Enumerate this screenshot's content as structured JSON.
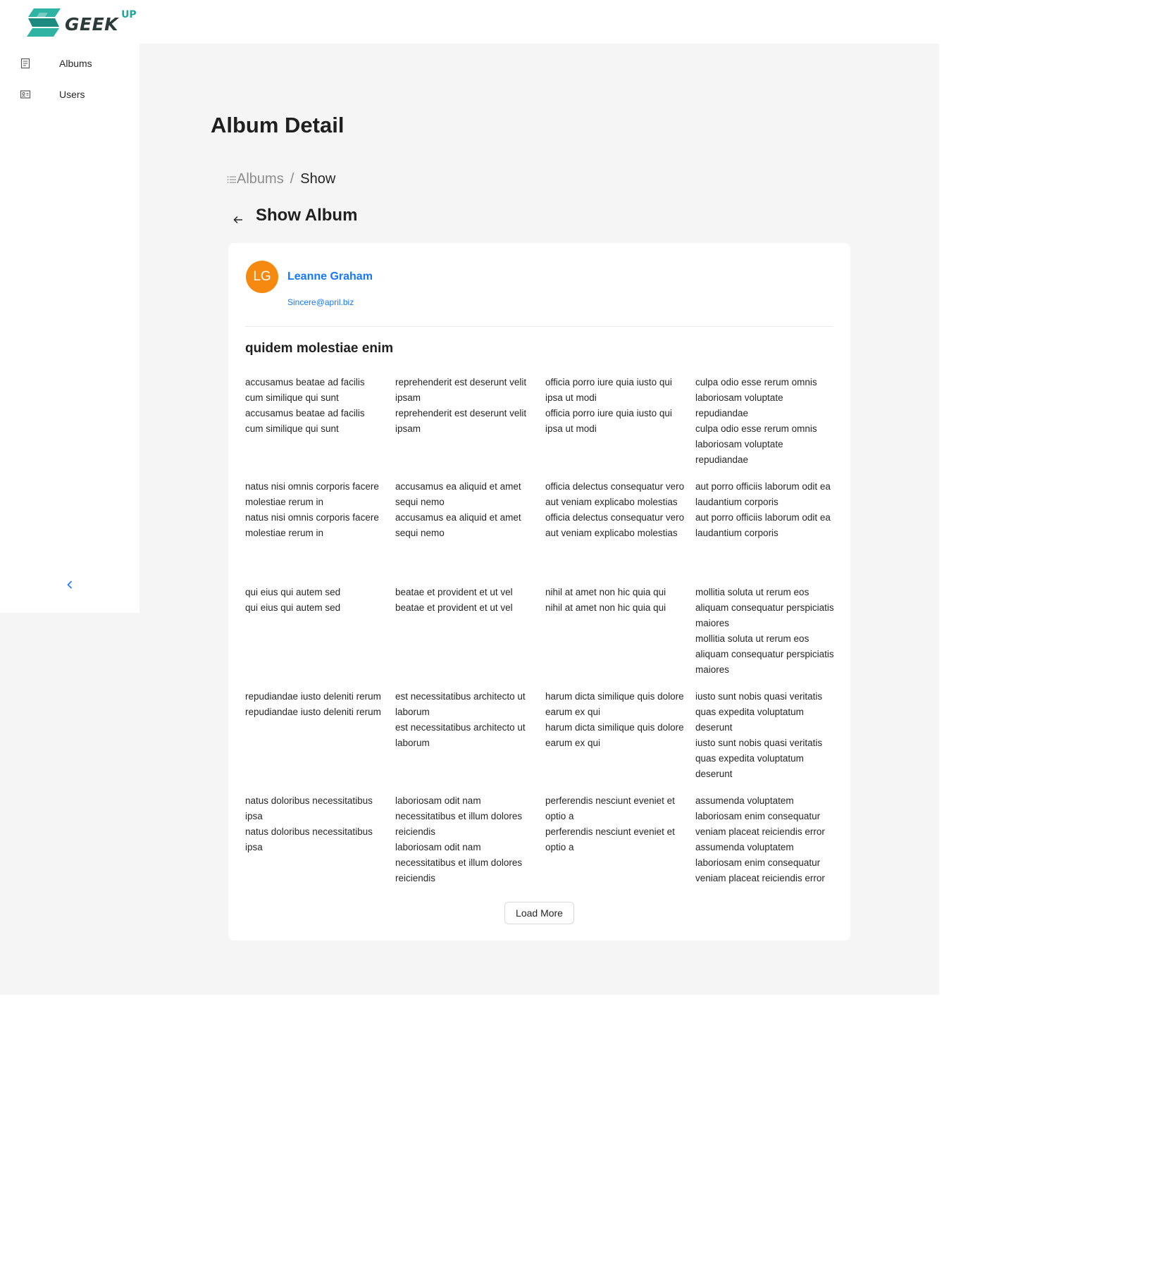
{
  "brand": {
    "logo_text": "GEEK",
    "logo_sup": "UP",
    "accent": "#1fa89a"
  },
  "sidebar": {
    "items": [
      {
        "label": "Albums",
        "icon": "album-icon"
      },
      {
        "label": "Users",
        "icon": "id-card-icon"
      }
    ],
    "collapse_icon": "chevron-left-icon"
  },
  "page": {
    "title": "Album Detail"
  },
  "breadcrumb": {
    "root": "Albums",
    "separator": "/",
    "current": "Show"
  },
  "show": {
    "title": "Show Album",
    "back_icon": "arrow-left-icon"
  },
  "user": {
    "initials": "LG",
    "name": "Leanne Graham",
    "email": "Sincere@april.biz",
    "avatar_color": "#f6890f"
  },
  "album": {
    "title": "quidem molestiae enim",
    "photos": [
      {
        "alt": "accusamus beatae ad facilis cum similique qui sunt",
        "caption": "accusamus beatae ad facilis cum similique qui sunt"
      },
      {
        "alt": "reprehenderit est deserunt velit ipsam",
        "caption": "reprehenderit est deserunt velit ipsam"
      },
      {
        "alt": "officia porro iure quia iusto qui ipsa ut modi",
        "caption": "officia porro iure quia iusto qui ipsa ut modi"
      },
      {
        "alt": "culpa odio esse rerum omnis laboriosam voluptate repudiandae",
        "caption": "culpa odio esse rerum omnis laboriosam voluptate repudiandae"
      },
      {
        "alt": "natus nisi omnis corporis facere molestiae rerum in",
        "caption": "natus nisi omnis corporis facere molestiae rerum in"
      },
      {
        "alt": "accusamus ea aliquid et amet sequi nemo",
        "caption": "accusamus ea aliquid et amet sequi nemo"
      },
      {
        "alt": "officia delectus consequatur vero aut veniam explicabo molestias",
        "caption": "officia delectus consequatur vero aut veniam explicabo molestias"
      },
      {
        "alt": "aut porro officiis laborum odit ea laudantium corporis",
        "caption": "aut porro officiis laborum odit ea laudantium corporis"
      },
      {
        "alt": "qui eius qui autem sed",
        "caption": "qui eius qui autem sed"
      },
      {
        "alt": "beatae et provident et ut vel",
        "caption": "beatae et provident et ut vel"
      },
      {
        "alt": "nihil at amet non hic quia qui",
        "caption": "nihil at amet non hic quia qui"
      },
      {
        "alt": "mollitia soluta ut rerum eos aliquam consequatur perspiciatis maiores",
        "caption": "mollitia soluta ut rerum eos aliquam consequatur perspiciatis maiores"
      },
      {
        "alt": "repudiandae iusto deleniti rerum",
        "caption": "repudiandae iusto deleniti rerum"
      },
      {
        "alt": "est necessitatibus architecto ut laborum",
        "caption": "est necessitatibus architecto ut laborum"
      },
      {
        "alt": "harum dicta similique quis dolore earum ex qui",
        "caption": "harum dicta similique quis dolore earum ex qui"
      },
      {
        "alt": "iusto sunt nobis quasi veritatis quas expedita voluptatum deserunt",
        "caption": "iusto sunt nobis quasi veritatis quas expedita voluptatum deserunt"
      },
      {
        "alt": "natus doloribus necessitatibus ipsa",
        "caption": "natus doloribus necessitatibus ipsa"
      },
      {
        "alt": "laboriosam odit nam necessitatibus et illum dolores reiciendis",
        "caption": "laboriosam odit nam necessitatibus et illum dolores reiciendis"
      },
      {
        "alt": "perferendis nesciunt eveniet et optio a",
        "caption": "perferendis nesciunt eveniet et optio a"
      },
      {
        "alt": "assumenda voluptatem laboriosam enim consequatur veniam placeat reiciendis error",
        "caption": "assumenda voluptatem laboriosam enim consequatur veniam placeat reiciendis error"
      }
    ]
  },
  "actions": {
    "load_more": "Load More"
  }
}
